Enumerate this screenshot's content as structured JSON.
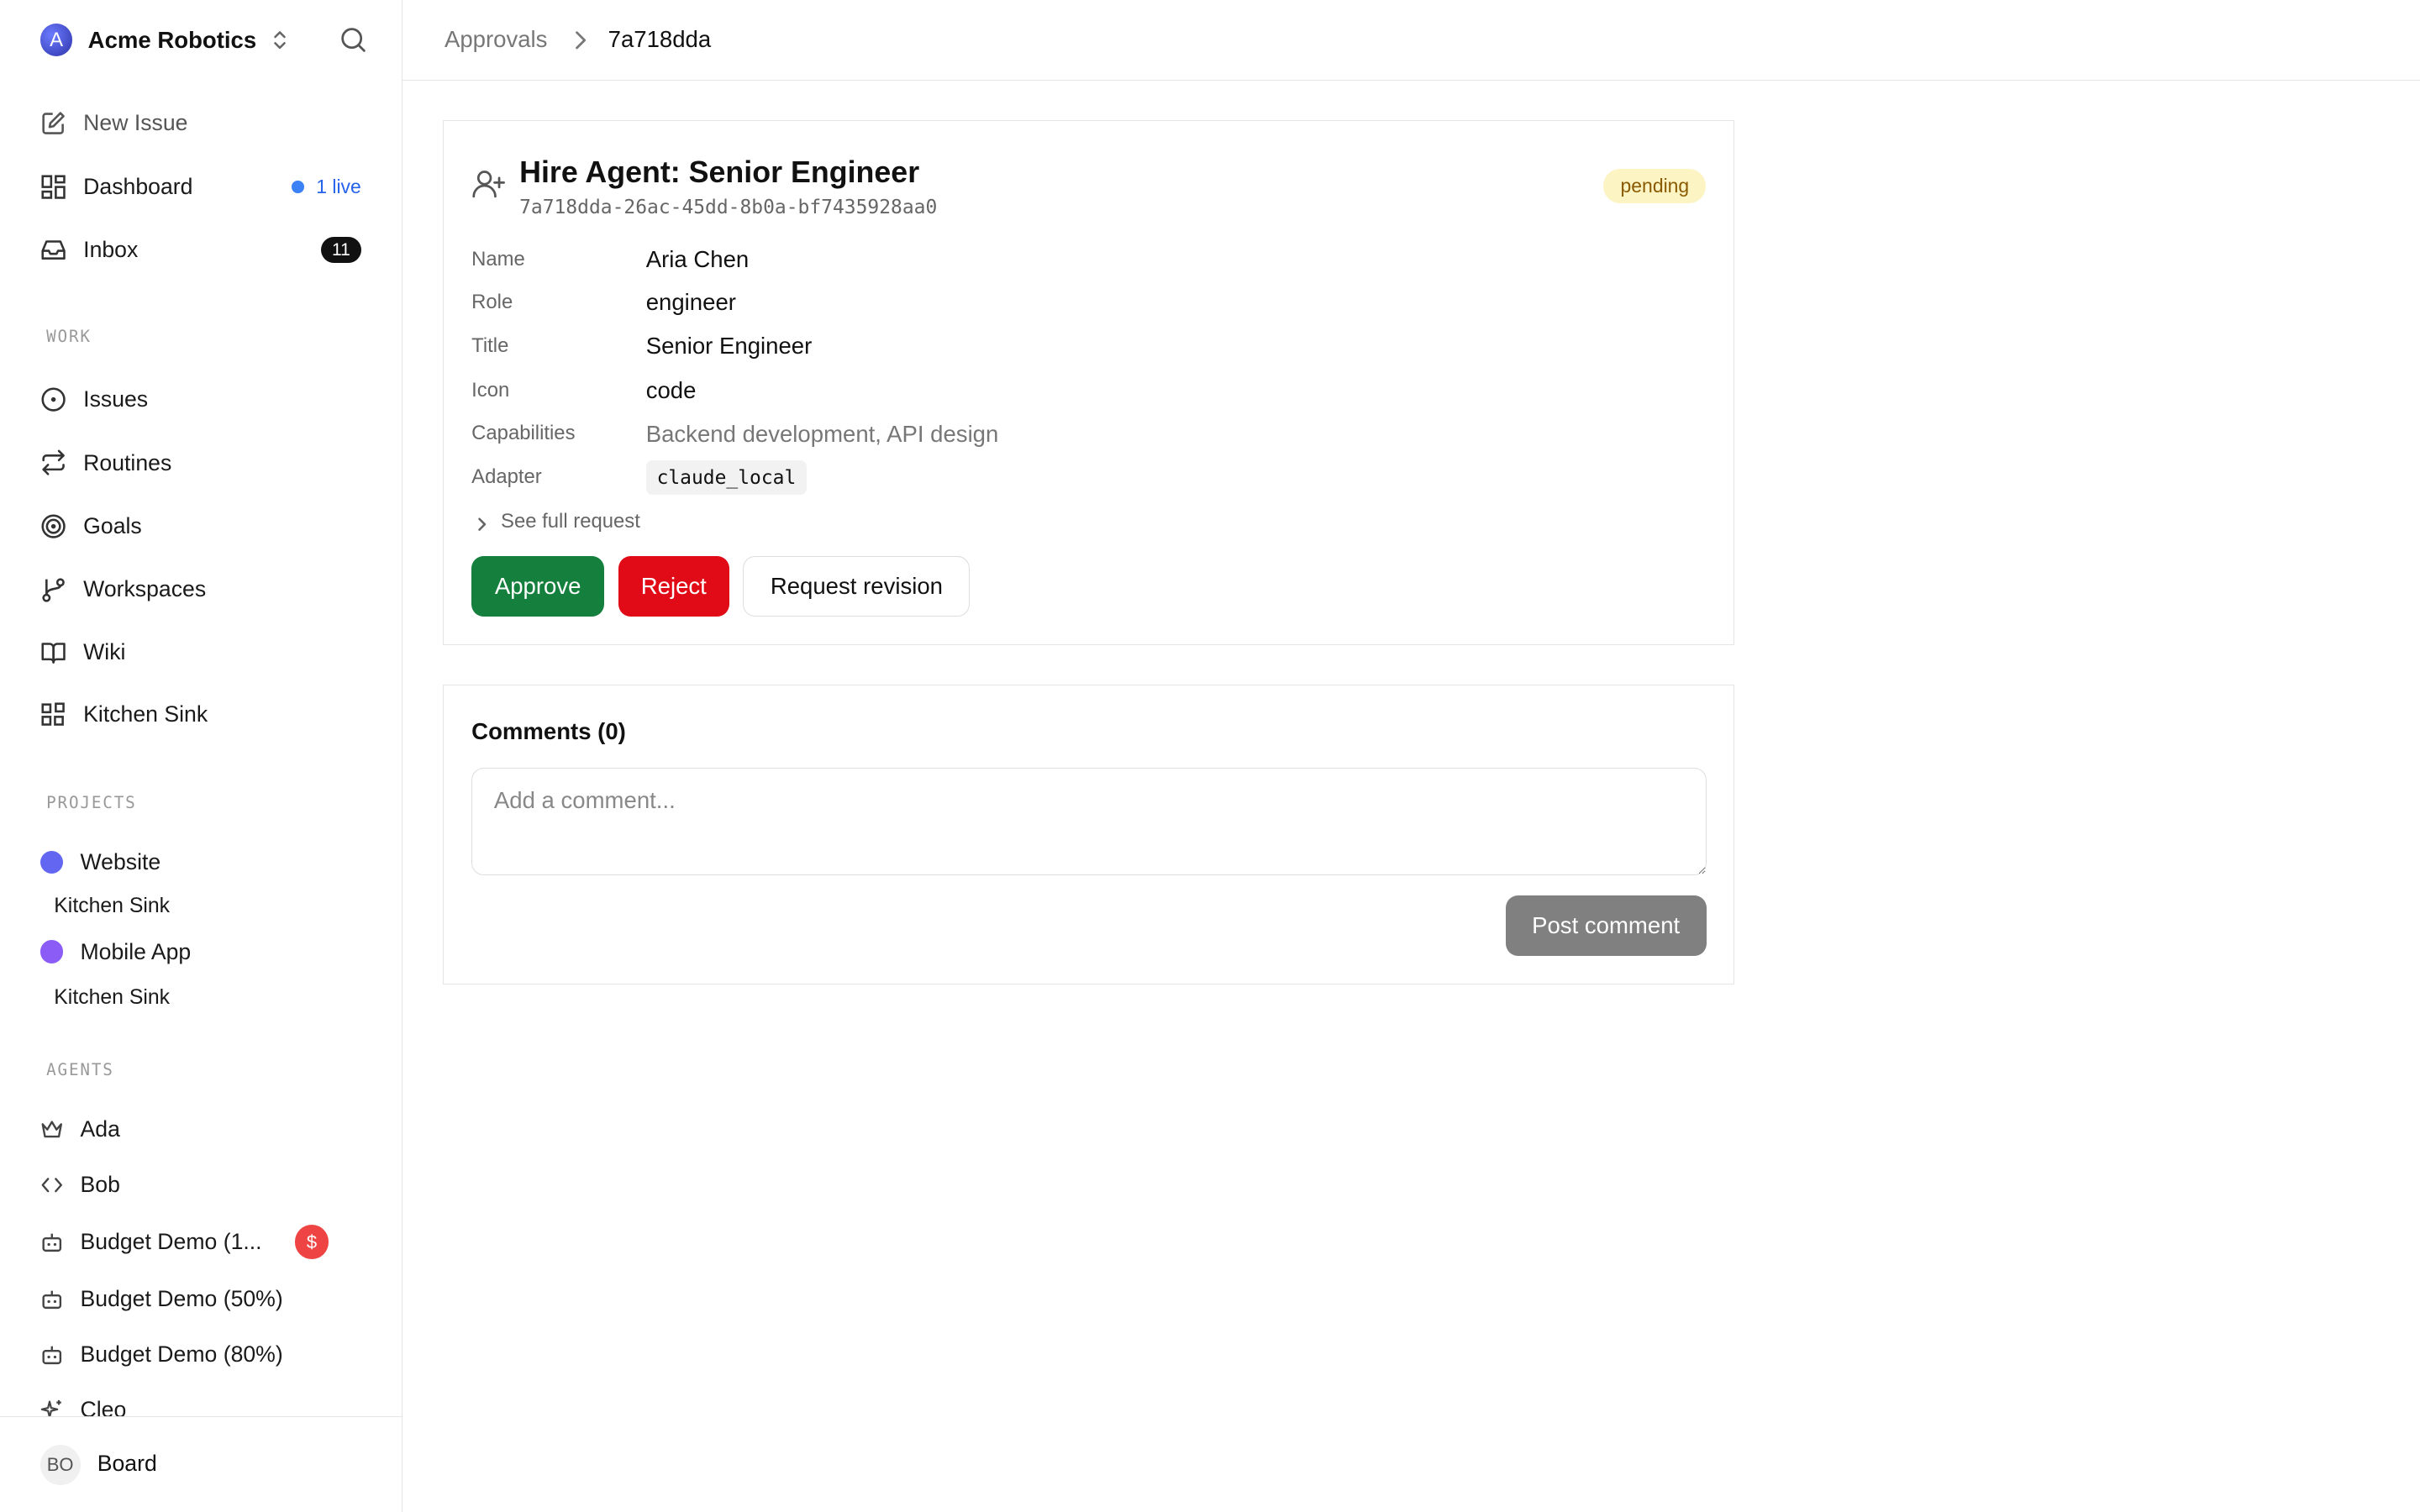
{
  "sidebar": {
    "company": {
      "logo_letter": "A",
      "name": "Acme Robotics"
    },
    "nav": [
      {
        "label": "New Issue",
        "icon": "pencil-square-icon"
      },
      {
        "label": "Dashboard",
        "icon": "dashboard-icon",
        "live": "1 live"
      },
      {
        "label": "Inbox",
        "icon": "inbox-icon",
        "count": "11"
      }
    ],
    "sections": {
      "work": "WORK",
      "projects": "PROJECTS",
      "agents": "AGENTS"
    },
    "work_items": [
      {
        "label": "Issues",
        "icon": "circle-dot-icon"
      },
      {
        "label": "Routines",
        "icon": "repeat-icon"
      },
      {
        "label": "Goals",
        "icon": "target-icon"
      },
      {
        "label": "Workspaces",
        "icon": "git-branch-icon"
      },
      {
        "label": "Wiki",
        "icon": "book-icon"
      },
      {
        "label": "Kitchen Sink",
        "icon": "blocks-icon"
      }
    ],
    "projects": [
      {
        "label": "Website",
        "color": "#6366f1",
        "sub": "Kitchen Sink"
      },
      {
        "label": "Mobile App",
        "color": "#8b5cf6",
        "sub": "Kitchen Sink"
      }
    ],
    "agents": [
      {
        "label": "Ada",
        "icon": "crown-icon"
      },
      {
        "label": "Bob",
        "icon": "code-icon"
      },
      {
        "label": "Budget Demo (1...",
        "icon": "bot-icon",
        "badge": "$"
      },
      {
        "label": "Budget Demo (50%)",
        "icon": "bot-icon"
      },
      {
        "label": "Budget Demo (80%)",
        "icon": "bot-icon"
      },
      {
        "label": "Cleo",
        "icon": "sparkles-icon"
      }
    ],
    "user": {
      "initials": "BO",
      "name": "Board"
    }
  },
  "breadcrumb": {
    "parent": "Approvals",
    "current": "7a718dda"
  },
  "approval": {
    "title": "Hire Agent: Senior Engineer",
    "id": "7a718dda-26ac-45dd-8b0a-bf7435928aa0",
    "status": "pending",
    "fields": {
      "name": {
        "label": "Name",
        "value": "Aria Chen"
      },
      "role": {
        "label": "Role",
        "value": "engineer"
      },
      "title": {
        "label": "Title",
        "value": "Senior Engineer"
      },
      "icon": {
        "label": "Icon",
        "value": "code"
      },
      "capabilities": {
        "label": "Capabilities",
        "value": "Backend development, API design"
      },
      "adapter": {
        "label": "Adapter",
        "value": "claude_local"
      }
    },
    "see_full": "See full request",
    "actions": {
      "approve": "Approve",
      "reject": "Reject",
      "revise": "Request revision"
    }
  },
  "comments": {
    "title": "Comments (0)",
    "placeholder": "Add a comment...",
    "post_label": "Post comment"
  }
}
